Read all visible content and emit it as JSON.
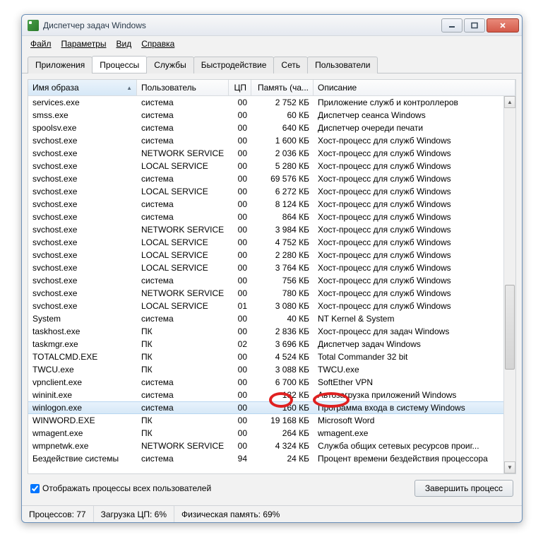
{
  "window": {
    "title": "Диспетчер задач Windows"
  },
  "menu": {
    "file": "Файл",
    "options": "Параметры",
    "view": "Вид",
    "help": "Справка"
  },
  "tabs": [
    {
      "id": "apps",
      "label": "Приложения"
    },
    {
      "id": "procs",
      "label": "Процессы"
    },
    {
      "id": "services",
      "label": "Службы"
    },
    {
      "id": "perf",
      "label": "Быстродействие"
    },
    {
      "id": "net",
      "label": "Сеть"
    },
    {
      "id": "users",
      "label": "Пользователи"
    }
  ],
  "active_tab": "procs",
  "columns": {
    "image": "Имя образа",
    "user": "Пользователь",
    "cpu": "ЦП",
    "mem": "Память (ча...",
    "desc": "Описание"
  },
  "rows": [
    {
      "image": "services.exe",
      "user": "система",
      "cpu": "00",
      "mem": "2 752 КБ",
      "desc": "Приложение служб и контроллеров"
    },
    {
      "image": "smss.exe",
      "user": "система",
      "cpu": "00",
      "mem": "60 КБ",
      "desc": "Диспетчер сеанса  Windows"
    },
    {
      "image": "spoolsv.exe",
      "user": "система",
      "cpu": "00",
      "mem": "640 КБ",
      "desc": "Диспетчер очереди печати"
    },
    {
      "image": "svchost.exe",
      "user": "система",
      "cpu": "00",
      "mem": "1 600 КБ",
      "desc": "Хост-процесс для служб Windows"
    },
    {
      "image": "svchost.exe",
      "user": "NETWORK SERVICE",
      "cpu": "00",
      "mem": "2 036 КБ",
      "desc": "Хост-процесс для служб Windows"
    },
    {
      "image": "svchost.exe",
      "user": "LOCAL SERVICE",
      "cpu": "00",
      "mem": "5 280 КБ",
      "desc": "Хост-процесс для служб Windows"
    },
    {
      "image": "svchost.exe",
      "user": "система",
      "cpu": "00",
      "mem": "69 576 КБ",
      "desc": "Хост-процесс для служб Windows"
    },
    {
      "image": "svchost.exe",
      "user": "LOCAL SERVICE",
      "cpu": "00",
      "mem": "6 272 КБ",
      "desc": "Хост-процесс для служб Windows"
    },
    {
      "image": "svchost.exe",
      "user": "система",
      "cpu": "00",
      "mem": "8 124 КБ",
      "desc": "Хост-процесс для служб Windows"
    },
    {
      "image": "svchost.exe",
      "user": "система",
      "cpu": "00",
      "mem": "864 КБ",
      "desc": "Хост-процесс для служб Windows"
    },
    {
      "image": "svchost.exe",
      "user": "NETWORK SERVICE",
      "cpu": "00",
      "mem": "3 984 КБ",
      "desc": "Хост-процесс для служб Windows"
    },
    {
      "image": "svchost.exe",
      "user": "LOCAL SERVICE",
      "cpu": "00",
      "mem": "4 752 КБ",
      "desc": "Хост-процесс для служб Windows"
    },
    {
      "image": "svchost.exe",
      "user": "LOCAL SERVICE",
      "cpu": "00",
      "mem": "2 280 КБ",
      "desc": "Хост-процесс для служб Windows"
    },
    {
      "image": "svchost.exe",
      "user": "LOCAL SERVICE",
      "cpu": "00",
      "mem": "3 764 КБ",
      "desc": "Хост-процесс для служб Windows"
    },
    {
      "image": "svchost.exe",
      "user": "система",
      "cpu": "00",
      "mem": "756 КБ",
      "desc": "Хост-процесс для служб Windows"
    },
    {
      "image": "svchost.exe",
      "user": "NETWORK SERVICE",
      "cpu": "00",
      "mem": "780 КБ",
      "desc": "Хост-процесс для служб Windows"
    },
    {
      "image": "svchost.exe",
      "user": "LOCAL SERVICE",
      "cpu": "01",
      "mem": "3 080 КБ",
      "desc": "Хост-процесс для служб Windows"
    },
    {
      "image": "System",
      "user": "система",
      "cpu": "00",
      "mem": "40 КБ",
      "desc": "NT Kernel & System"
    },
    {
      "image": "taskhost.exe",
      "user": "ПК",
      "cpu": "00",
      "mem": "2 836 КБ",
      "desc": "Хост-процесс для задач Windows"
    },
    {
      "image": "taskmgr.exe",
      "user": "ПК",
      "cpu": "02",
      "mem": "3 696 КБ",
      "desc": "Диспетчер задач Windows"
    },
    {
      "image": "TOTALCMD.EXE",
      "user": "ПК",
      "cpu": "00",
      "mem": "4 524 КБ",
      "desc": "Total Commander 32 bit"
    },
    {
      "image": "TWCU.exe",
      "user": "ПК",
      "cpu": "00",
      "mem": "3 088 КБ",
      "desc": "TWCU.exe"
    },
    {
      "image": "vpnclient.exe",
      "user": "система",
      "cpu": "00",
      "mem": "6 700 КБ",
      "desc": "SoftEther VPN"
    },
    {
      "image": "wininit.exe",
      "user": "система",
      "cpu": "00",
      "mem": "132 КБ",
      "desc": "Автозагрузка приложений Windows"
    },
    {
      "image": "winlogon.exe",
      "user": "система",
      "cpu": "00",
      "mem": "160 КБ",
      "desc": "Программа входа в систему Windows",
      "selected": true
    },
    {
      "image": "WINWORD.EXE",
      "user": "ПК",
      "cpu": "00",
      "mem": "19 168 КБ",
      "desc": "Microsoft Word"
    },
    {
      "image": "wmagent.exe",
      "user": "ПК",
      "cpu": "00",
      "mem": "264 КБ",
      "desc": "wmagent.exe"
    },
    {
      "image": "wmpnetwk.exe",
      "user": "NETWORK SERVICE",
      "cpu": "00",
      "mem": "4 324 КБ",
      "desc": "Служба общих сетевых ресурсов проиг..."
    },
    {
      "image": "Бездействие системы",
      "user": "система",
      "cpu": "94",
      "mem": "24 КБ",
      "desc": "Процент времени бездействия процессора"
    }
  ],
  "show_all": {
    "label": "Отображать процессы всех пользователей",
    "checked": true
  },
  "end_process": "Завершить процесс",
  "status": {
    "procs_label": "Процессов:",
    "procs_val": "77",
    "cpu_label": "Загрузка ЦП:",
    "cpu_val": "6%",
    "mem_label": "Физическая память:",
    "mem_val": "69%"
  }
}
